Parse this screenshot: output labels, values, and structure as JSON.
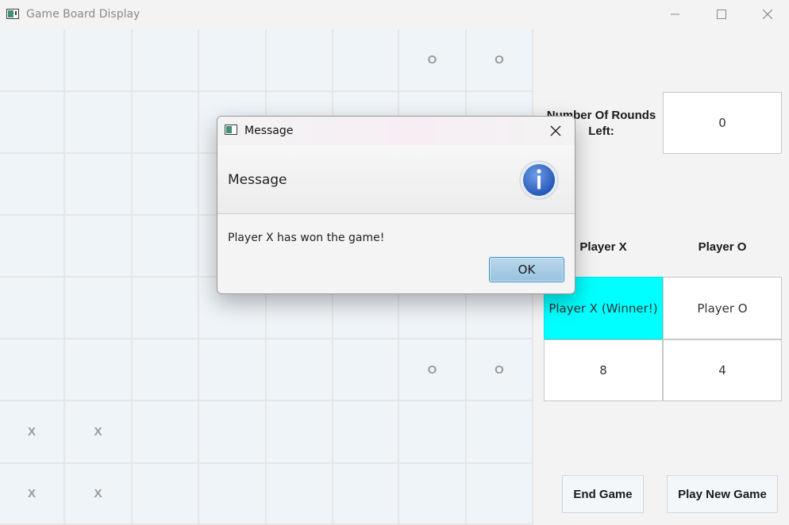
{
  "window": {
    "title": "Game Board Display",
    "icon": "app-window-icon",
    "controls": [
      "minimize-icon",
      "maximize-icon",
      "close-icon"
    ]
  },
  "board": {
    "rows": 8,
    "cols": 8,
    "cells": [
      [
        "",
        "",
        "",
        "",
        "",
        "",
        "O",
        "O"
      ],
      [
        "",
        "",
        "",
        "",
        "",
        "",
        "",
        ""
      ],
      [
        "",
        "",
        "",
        "",
        "",
        "",
        "",
        ""
      ],
      [
        "",
        "",
        "",
        "",
        "",
        "",
        "",
        ""
      ],
      [
        "",
        "",
        "",
        "",
        "",
        "",
        "",
        ""
      ],
      [
        "",
        "",
        "",
        "",
        "",
        "",
        "O",
        "O"
      ],
      [
        "X",
        "X",
        "",
        "",
        "",
        "",
        "",
        ""
      ],
      [
        "X",
        "X",
        "",
        "",
        "",
        "",
        "",
        ""
      ]
    ]
  },
  "side_panel": {
    "rounds_label": "Number Of Rounds Left:",
    "rounds_value": "0",
    "player_x_header": "Player X",
    "player_o_header": "Player O",
    "player_x_name": "Player X (Winner!)",
    "player_o_name": "Player O",
    "player_x_score": "8",
    "player_o_score": "4",
    "winner_color": "#00ffff",
    "end_game_label": "End Game",
    "play_new_game_label": "Play New Game"
  },
  "dialog": {
    "title": "Message",
    "header_text": "Message",
    "icon": "info-icon",
    "content": "Player X has won the game!",
    "ok_label": "OK"
  }
}
